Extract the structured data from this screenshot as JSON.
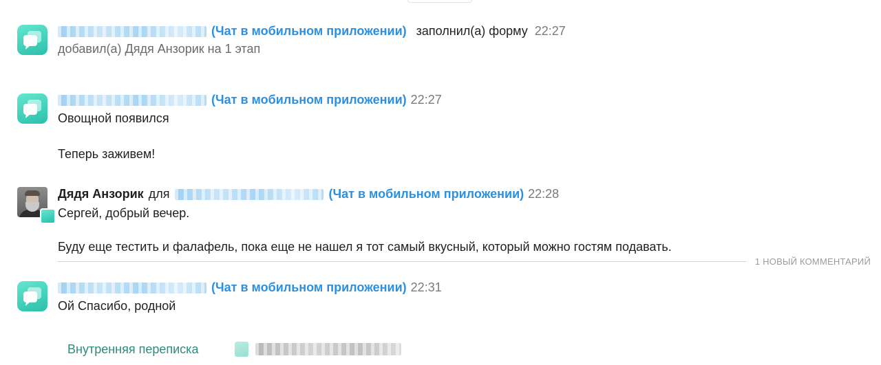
{
  "channel_label": "(Чат в мобильном приложении)",
  "entries": [
    {
      "action": "заполнил(а) форму",
      "time": "22:27",
      "subline": "добавил(а) Дядя Анзорик на 1 этап"
    },
    {
      "time": "22:27",
      "lines": [
        "Овощной появился",
        "Теперь заживем!"
      ]
    },
    {
      "author": "Дядя Анзорик",
      "for_word": "для",
      "time": "22:28",
      "lines": [
        "Сергей, добрый вечер.",
        "Буду еще тестить и фалафель, пока еще не нашел я тот самый вкусный, который можно гостям подавать."
      ]
    },
    {
      "time": "22:31",
      "lines": [
        "Ой Спасибо, родной"
      ]
    }
  ],
  "new_comments_label": "1 НОВЫЙ КОММЕНТАРИЙ",
  "footer": {
    "internal_link": "Внутренняя переписка"
  },
  "icons": {
    "app": "chat-bubble-icon",
    "avatar": "user-avatar"
  },
  "colors": {
    "link": "#2d8fe0",
    "app_icon": "#3ccfb6",
    "muted": "#7a7a7a"
  }
}
